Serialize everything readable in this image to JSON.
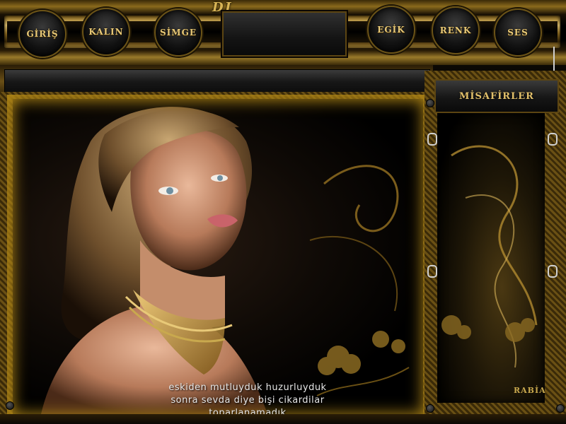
{
  "header": {
    "logo": "DJ",
    "buttons": [
      {
        "label": "GİRİŞ"
      },
      {
        "label": "KALIN"
      },
      {
        "label": "SİMGE"
      },
      {
        "label": "EGİK"
      },
      {
        "label": "RENK"
      },
      {
        "label": "SES"
      }
    ],
    "center_display": ""
  },
  "input_bar": {
    "value": ""
  },
  "sidebar": {
    "title": "MİSAFİRLER",
    "users": []
  },
  "main": {
    "caption_lines": [
      "eskiden mutluyduk huzurluyduk",
      "sonra sevda diye bişi cikardilar",
      "toparlanamadık"
    ]
  },
  "signature": "RABİA",
  "colors": {
    "gold": "#e8c978",
    "frame_dark": "#3a2a08",
    "panel_dark": "#141414"
  }
}
